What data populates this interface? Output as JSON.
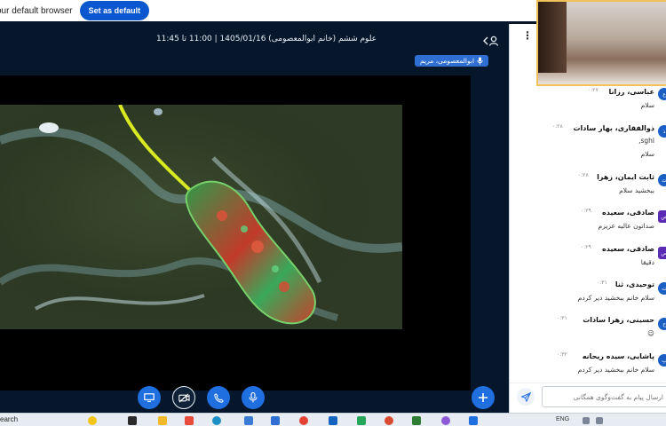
{
  "browser_bar": {
    "message": "our default browser",
    "set_default_label": "Set as default"
  },
  "meeting": {
    "title": "علوم ششم (خانم ابوالمعصومی) 1405/01/16 | 11:00 تا 11:45",
    "presenter": "ابوالمعصومی، مریم"
  },
  "chat": {
    "messages": [
      {
        "name": "عباسی، رزانا",
        "time": "۰:۲۷",
        "text": "سلام",
        "avatar": "ع"
      },
      {
        "name": "ذوالفقاری، بهار سادات",
        "time": "۰:۲۸",
        "text": "sghl,",
        "text2": "سلام",
        "avatar": "ذ"
      },
      {
        "name": "ثابت ایمان، زهرا",
        "time": "۰:۲۸",
        "text": "ببخشید سلام",
        "avatar": "ث"
      },
      {
        "name": "صادقی، سعیده",
        "time": "۰:۲۹",
        "text": "صداتون عالیه عزیزم",
        "avatar": "ص"
      },
      {
        "name": "صادقی، سعیده",
        "time": "۰:۲۹",
        "text": "دقیقا",
        "avatar": "ص"
      },
      {
        "name": "توحیدی، ثنا",
        "time": "۰:۳۱",
        "text": "سلام خانم ببخشید دیر کردم",
        "avatar": "ت"
      },
      {
        "name": "حسینی، زهرا سادات",
        "time": "۰:۳۱",
        "text": "😉",
        "avatar": "ح"
      },
      {
        "name": "پاشایی، سیده ریحانه",
        "time": "۰:۳۲",
        "text": "سلام خانم ببخشید دیر کردم",
        "avatar": "پ"
      }
    ],
    "input_placeholder": "ارسال پیام به گفت‌وگوی همگانی"
  },
  "taskbar": {
    "search_label": "earch",
    "tray_lang": "ENG"
  },
  "colors": {
    "meeting_bg": "#06172b",
    "primary": "#1f6fe0",
    "browser_button": "#0b57d0"
  }
}
